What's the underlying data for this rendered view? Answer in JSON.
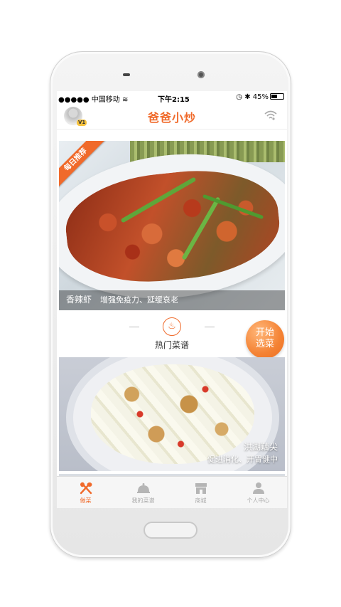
{
  "status_bar": {
    "carrier": "●●●●● 中国移动",
    "time": "下午2:15",
    "battery": "45%"
  },
  "app_bar": {
    "title": "爸爸小炒",
    "level_badge": "V1"
  },
  "featured": {
    "ribbon": "每日推荐",
    "dish_name": "香辣虾",
    "description": "增强免疫力、延缓衰老"
  },
  "hot_recipes": {
    "title": "热门菜谱",
    "start_button": [
      "开始",
      "选菜"
    ]
  },
  "recipes": [
    {
      "name": "洪湖藕尖",
      "description": "促进消化、开胃健中"
    }
  ],
  "tab_bar": {
    "tabs": [
      {
        "label": "做菜",
        "icon": "cooking-tools-icon",
        "active": true
      },
      {
        "label": "我的菜谱",
        "icon": "cloche-icon",
        "active": false
      },
      {
        "label": "商城",
        "icon": "shop-icon",
        "active": false
      },
      {
        "label": "个人中心",
        "icon": "person-icon",
        "active": false
      }
    ]
  },
  "colors": {
    "accent": "#f06a2b"
  }
}
